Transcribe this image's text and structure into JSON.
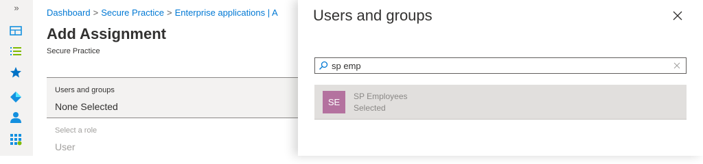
{
  "rail": {
    "expand_glyph": "»",
    "icons": [
      "dashboard-icon",
      "all-services-icon",
      "favorites-star-icon",
      "azure-ad-icon",
      "users-icon",
      "all-resources-icon"
    ],
    "accent": "#0078d4"
  },
  "main": {
    "breadcrumb": {
      "items": [
        "Dashboard",
        "Secure Practice",
        "Enterprise applications | A"
      ],
      "separator": ">"
    },
    "title": "Add Assignment",
    "subtitle": "Secure Practice",
    "users_groups": {
      "label": "Users and groups",
      "value": "None Selected"
    },
    "role": {
      "label": "Select a role",
      "value": "User"
    }
  },
  "panel": {
    "title": "Users and groups",
    "search": {
      "value": "sp emp",
      "placeholder": ""
    },
    "results": [
      {
        "initials": "SE",
        "name": "SP Employees",
        "status": "Selected",
        "avatar_color": "#b4729f"
      }
    ]
  }
}
